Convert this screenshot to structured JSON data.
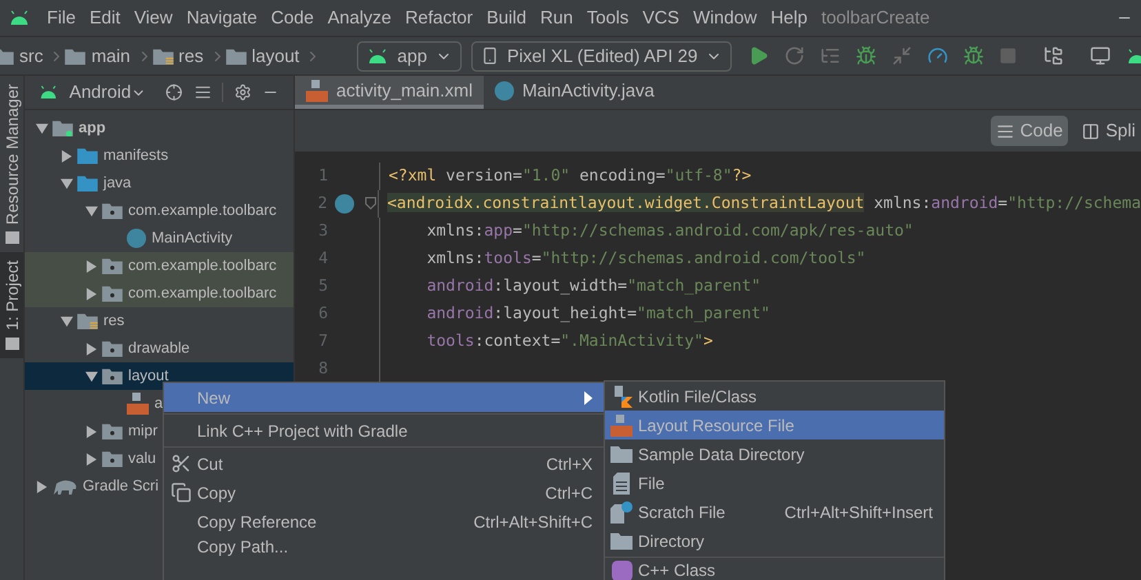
{
  "menu_bar": {
    "items": [
      "File",
      "Edit",
      "View",
      "Navigate",
      "Code",
      "Analyze",
      "Refactor",
      "Build",
      "Run",
      "Tools",
      "VCS",
      "Window",
      "Help"
    ],
    "title": "toolbarCreate"
  },
  "breadcrumbs": [
    {
      "label": "src",
      "kind": "folder"
    },
    {
      "label": "main",
      "kind": "folder"
    },
    {
      "label": "res",
      "kind": "res"
    },
    {
      "label": "layout",
      "kind": "folder"
    }
  ],
  "run_config": "app",
  "device": "Pixel XL (Edited) API 29",
  "side_tabs": [
    {
      "label": "Resource Manager",
      "selected": false
    },
    {
      "label": "1: Project",
      "selected": true
    }
  ],
  "project_panel": {
    "view": "Android",
    "tree": [
      {
        "label": "app",
        "kind": "module",
        "expanded": true,
        "selected": false,
        "marked": false,
        "children": [
          {
            "label": "manifests",
            "kind": "folder",
            "expanded": false,
            "selected": false,
            "marked": false
          },
          {
            "label": "java",
            "kind": "folder",
            "expanded": true,
            "selected": false,
            "marked": false,
            "children": [
              {
                "label": "com.example.toolbarc",
                "kind": "package",
                "expanded": true,
                "selected": false,
                "marked": false,
                "children": [
                  {
                    "label": "MainActivity",
                    "kind": "class",
                    "selected": false,
                    "marked": false
                  }
                ]
              },
              {
                "label": "com.example.toolbarc",
                "kind": "package",
                "expanded": false,
                "selected": false,
                "marked": true
              },
              {
                "label": "com.example.toolbarc",
                "kind": "package",
                "expanded": false,
                "selected": false,
                "marked": true
              }
            ]
          },
          {
            "label": "res",
            "kind": "res",
            "expanded": true,
            "selected": false,
            "marked": false,
            "children": [
              {
                "label": "drawable",
                "kind": "package",
                "expanded": false,
                "selected": false,
                "marked": false
              },
              {
                "label": "layout",
                "kind": "package",
                "expanded": true,
                "selected": true,
                "children": [
                  {
                    "label": "a",
                    "kind": "layout-file",
                    "selected": false,
                    "marked": false
                  }
                ]
              },
              {
                "label": "mipr",
                "kind": "package",
                "expanded": false,
                "selected": false,
                "marked": false
              },
              {
                "label": "valu",
                "kind": "package",
                "expanded": false,
                "selected": false,
                "marked": false
              }
            ]
          }
        ]
      },
      {
        "label": "Gradle Scri",
        "kind": "gradle",
        "expanded": false,
        "selected": false,
        "marked": false
      }
    ]
  },
  "editor": {
    "tabs": [
      {
        "label": "activity_main.xml",
        "kind": "xml",
        "selected": true
      },
      {
        "label": "MainActivity.java",
        "kind": "class",
        "selected": false
      }
    ],
    "view_modes": [
      {
        "label": "Code",
        "selected": true
      },
      {
        "label": "Spli",
        "selected": false
      }
    ],
    "lines": [
      {
        "number": "1",
        "marker": false,
        "tokens": [
          {
            "t": "<?xml",
            "kind": "tag"
          },
          {
            "t": " version=",
            "kind": "plain"
          },
          {
            "t": "\"1.0\"",
            "kind": "value"
          },
          {
            "t": " encoding=",
            "kind": "plain"
          },
          {
            "t": "\"utf-8\"",
            "kind": "value"
          },
          {
            "t": "?>",
            "kind": "tag"
          }
        ]
      },
      {
        "number": "2",
        "marker": true,
        "tokens": [
          {
            "t": "<androidx.constraintlayout.widget.",
            "kind": "tag-hl"
          },
          {
            "t": "ConstraintLayout",
            "kind": "tag-hl2"
          },
          {
            "t": " xmlns:",
            "kind": "plain"
          },
          {
            "t": "android",
            "kind": "ns"
          },
          {
            "t": "=",
            "kind": "plain"
          },
          {
            "t": "\"http://schema",
            "kind": "value"
          }
        ]
      },
      {
        "number": "3",
        "marker": false,
        "tokens": [
          {
            "t": "    xmlns:",
            "kind": "plain"
          },
          {
            "t": "app",
            "kind": "ns"
          },
          {
            "t": "=",
            "kind": "plain"
          },
          {
            "t": "\"http://schemas.android.com/apk/res-auto\"",
            "kind": "value"
          }
        ]
      },
      {
        "number": "4",
        "marker": false,
        "tokens": [
          {
            "t": "    xmlns:",
            "kind": "plain"
          },
          {
            "t": "tools",
            "kind": "ns"
          },
          {
            "t": "=",
            "kind": "plain"
          },
          {
            "t": "\"http://schemas.android.com/tools\"",
            "kind": "value"
          }
        ]
      },
      {
        "number": "5",
        "marker": false,
        "tokens": [
          {
            "t": "    android",
            "kind": "ns"
          },
          {
            "t": ":layout_width=",
            "kind": "plain"
          },
          {
            "t": "\"match_parent\"",
            "kind": "value"
          }
        ]
      },
      {
        "number": "6",
        "marker": false,
        "tokens": [
          {
            "t": "    android",
            "kind": "ns"
          },
          {
            "t": ":layout_height=",
            "kind": "plain"
          },
          {
            "t": "\"match_parent\"",
            "kind": "value"
          }
        ]
      },
      {
        "number": "7",
        "marker": false,
        "tokens": [
          {
            "t": "    tools",
            "kind": "ns"
          },
          {
            "t": ":context=",
            "kind": "plain"
          },
          {
            "t": "\".MainActivity\"",
            "kind": "value"
          },
          {
            "t": ">",
            "kind": "tag"
          }
        ]
      },
      {
        "number": "8",
        "marker": false
      }
    ]
  },
  "context_menu": {
    "items": [
      {
        "kind": "submenu",
        "label": "New",
        "selected": true
      },
      {
        "kind": "separator"
      },
      {
        "kind": "plain",
        "label": "Link C++ Project with Gradle",
        "selected": false
      },
      {
        "kind": "separator"
      },
      {
        "kind": "cut",
        "label": "Cut",
        "shortcut": "Ctrl+X",
        "selected": false
      },
      {
        "kind": "copy",
        "label": "Copy",
        "shortcut": "Ctrl+C",
        "selected": false
      },
      {
        "kind": "plain",
        "label": "Copy Reference",
        "shortcut": "Ctrl+Alt+Shift+C",
        "selected": false
      },
      {
        "kind": "plain",
        "label": "Copy Path...",
        "selected": false
      }
    ]
  },
  "submenu": {
    "items": [
      {
        "kind": "kotlin",
        "label": "Kotlin File/Class",
        "selected": false
      },
      {
        "kind": "layout",
        "label": "Layout Resource File",
        "selected": true
      },
      {
        "kind": "folder",
        "label": "Sample Data Directory",
        "selected": false
      },
      {
        "kind": "file",
        "label": "File",
        "selected": false
      },
      {
        "kind": "scratch",
        "label": "Scratch File",
        "shortcut": "Ctrl+Alt+Shift+Insert",
        "selected": false
      },
      {
        "kind": "folder",
        "label": "Directory",
        "selected": false
      },
      {
        "kind": "separator"
      },
      {
        "kind": "cpp",
        "label": "C++ Class",
        "selected": false
      }
    ]
  }
}
